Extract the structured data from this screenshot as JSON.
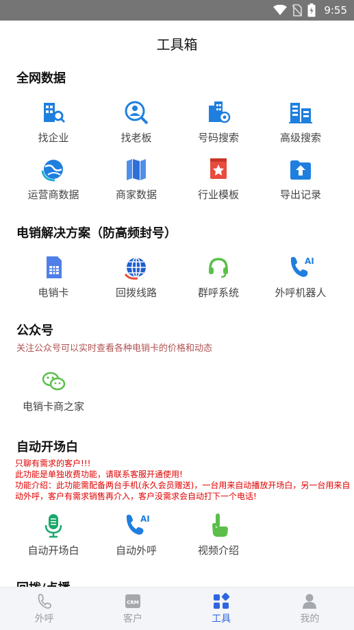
{
  "status_bar": {
    "time": "9:55",
    "icons": [
      "wifi-icon",
      "no-sim-icon",
      "battery-icon"
    ]
  },
  "header": {
    "title": "工具箱"
  },
  "sections": {
    "all_data": {
      "title": "全网数据",
      "items": [
        {
          "label": "找企业",
          "icon": "building-search-icon"
        },
        {
          "label": "找老板",
          "icon": "person-search-icon"
        },
        {
          "label": "号码搜索",
          "icon": "phone-search-icon"
        },
        {
          "label": "高级搜索",
          "icon": "advanced-search-icon"
        },
        {
          "label": "运营商数据",
          "icon": "globe-icon"
        },
        {
          "label": "商家数据",
          "icon": "map-icon"
        },
        {
          "label": "行业模板",
          "icon": "template-icon"
        },
        {
          "label": "导出记录",
          "icon": "export-icon"
        }
      ]
    },
    "telesales": {
      "title": "电销解决方案（防高频封号）",
      "items": [
        {
          "label": "电销卡",
          "icon": "sim-card-icon"
        },
        {
          "label": "回拨线路",
          "icon": "callback-line-icon"
        },
        {
          "label": "群呼系统",
          "icon": "headset-icon"
        },
        {
          "label": "外呼机器人",
          "icon": "ai-phone-icon"
        }
      ]
    },
    "official_account": {
      "title": "公众号",
      "subtitle": "关注公众号可以实时查看各种电销卡的价格和动态",
      "items": [
        {
          "label": "电销卡商之家",
          "icon": "wechat-icon"
        }
      ]
    },
    "auto_opening": {
      "title": "自动开场白",
      "notice": "只聊有需求的客户!!!\n此功能是单独收费功能，请联系客服开通使用!\n功能介绍：此功能需配备两台手机(永久会员赠送)，一台用来自动播放开场白，另一台用来自动外呼，客户有需求销售再介入，客户没需求会自动打下一个电话!",
      "items": [
        {
          "label": "自动开场白",
          "icon": "microphone-icon"
        },
        {
          "label": "自动外呼",
          "icon": "ai-phone-icon"
        },
        {
          "label": "视频介绍",
          "icon": "pointer-hand-icon"
        }
      ]
    },
    "callback": {
      "title": "回拨/点播"
    }
  },
  "tabbar": {
    "active": "工具",
    "tabs": [
      {
        "label": "外呼",
        "icon": "phone-tab-icon"
      },
      {
        "label": "客户",
        "icon": "crm-tab-icon"
      },
      {
        "label": "工具",
        "icon": "tools-tab-icon"
      },
      {
        "label": "我的",
        "icon": "profile-tab-icon"
      }
    ]
  },
  "colors": {
    "accent": "#2f66e0",
    "icon_blue": "#1f7fdf",
    "notice_red": "#e00000",
    "subtitle_red": "#b05050",
    "green": "#5bbf4a",
    "red_icon": "#e84c3d"
  }
}
